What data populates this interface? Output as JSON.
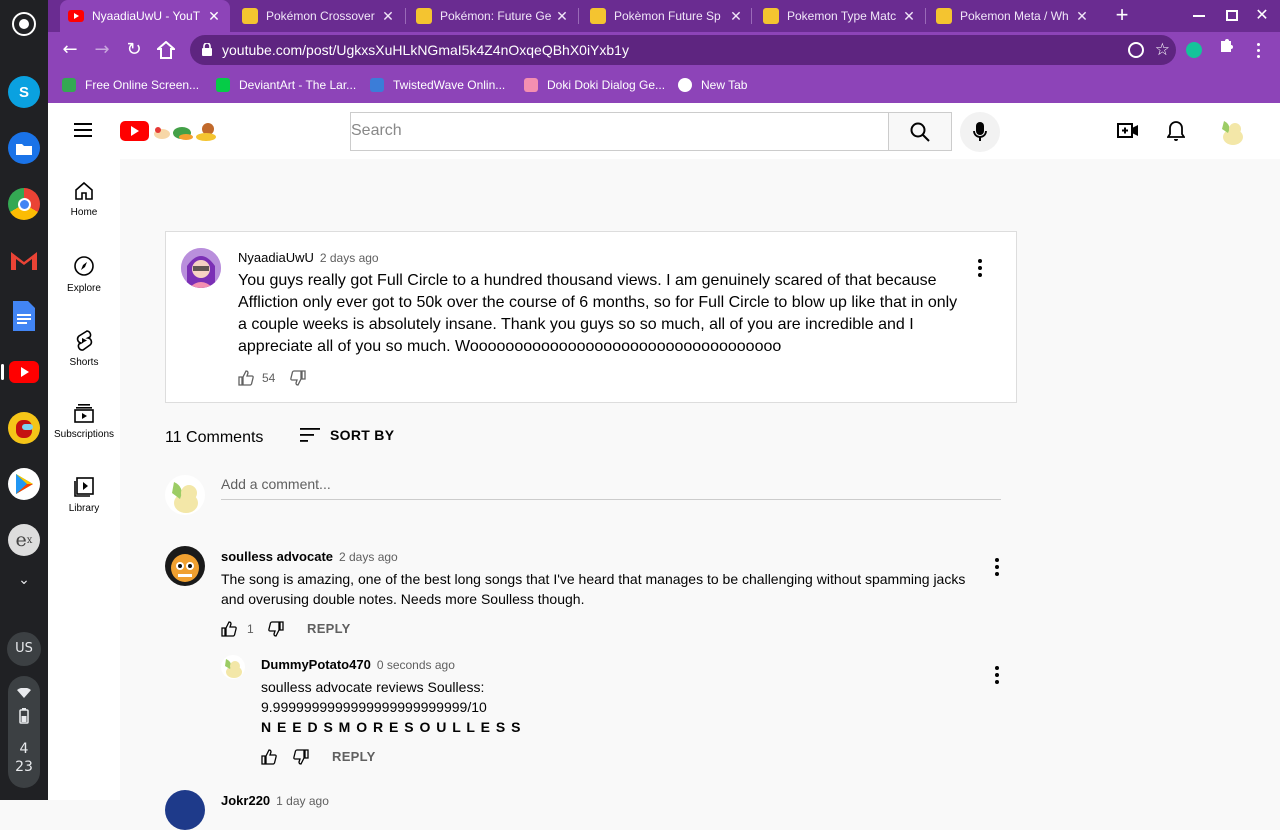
{
  "shelf": {
    "apps": [
      "screen-capture-app",
      "skype-app",
      "files-app",
      "chrome-app",
      "gmail-app",
      "docs-app",
      "youtube-app",
      "among-us-app",
      "play-store-app",
      "exponent-app",
      "shelf-expand"
    ],
    "user_badge": "US",
    "clock_hour": "4",
    "clock_minute": "23"
  },
  "browser": {
    "tabs": [
      {
        "title": "NyaadiaUwU - YouT",
        "active": true
      },
      {
        "title": "Pokémon Crossover"
      },
      {
        "title": "Pokémon: Future Ge"
      },
      {
        "title": "Pokèmon Future Sp"
      },
      {
        "title": "Pokemon Type Matc"
      },
      {
        "title": "Pokemon Meta / Wh"
      }
    ],
    "new_tab": "+",
    "url": "youtube.com/post/UgkxsXuHLkNGmaI5k4Z4nOxqeQBhX0iYxb1y",
    "bookmarks": [
      {
        "label": "Free Online Screen..."
      },
      {
        "label": "DeviantArt - The Lar..."
      },
      {
        "label": "TwistedWave Onlin..."
      },
      {
        "label": "Doki Doki Dialog Ge..."
      },
      {
        "label": "New Tab"
      }
    ]
  },
  "youtube": {
    "search_placeholder": "Search",
    "sidebar": [
      {
        "label": "Home"
      },
      {
        "label": "Explore"
      },
      {
        "label": "Shorts"
      },
      {
        "label": "Subscriptions"
      },
      {
        "label": "Library"
      }
    ],
    "post": {
      "author": "NyaadiaUwU",
      "time": "2 days ago",
      "text": "You guys really got Full Circle to a hundred thousand views. I am genuinely scared of that because Affliction only ever got to 50k over the course of 6 months, so for Full Circle to blow up like that in only a couple weeks is absolutely insane. Thank you guys so so much, all of you are incredible and I appreciate all of you so much. Wooooooooooooooooooooooooooooooooooo",
      "likes": "54"
    },
    "comments_count": "11 Comments",
    "sort_label": "SORT BY",
    "add_comment_placeholder": "Add a comment...",
    "comments": [
      {
        "author": "soulless advocate",
        "time": "2 days ago",
        "text": "The song is amazing, one of the best long songs that I've heard that manages to be challenging without spamming jacks and overusing double notes. Needs more Soulless though.",
        "likes": "1",
        "reply_label": "REPLY"
      }
    ],
    "reply": {
      "author": "DummyPotato470",
      "time": "0 seconds ago",
      "line1": "soulless advocate reviews Soulless:",
      "line2": "9.9999999999999999999999999/10",
      "line3": "N E E D S M O R E S O U L L E S S",
      "reply_label": "REPLY"
    },
    "next_comment": {
      "author": "Jokr220",
      "time": "1 day ago"
    }
  },
  "colors": {
    "chrome_frame": "#6a2c91",
    "chrome_toolbar": "#8d44b8",
    "youtube_red": "#ff0000"
  }
}
